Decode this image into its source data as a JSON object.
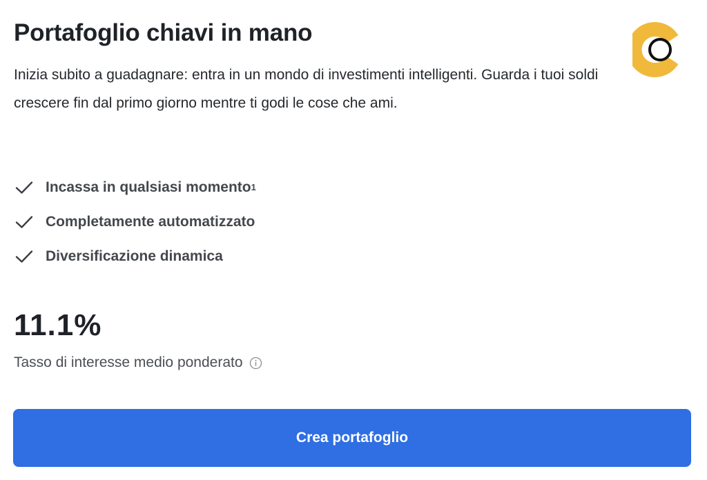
{
  "card": {
    "title": "Portafoglio chiavi in mano",
    "description": "Inizia subito a guadagnare: entra in un mondo di investimenti intelligenti. Guarda i tuoi soldi crescere fin dal primo giorno mentre ti godi le cose che ami.",
    "logo_icon": "brand-logo-icon",
    "features": [
      {
        "label": "Incassa in qualsiasi momento",
        "superscript": "1",
        "icon": "checkmark-icon"
      },
      {
        "label": "Completamente automatizzato",
        "icon": "checkmark-icon"
      },
      {
        "label": "Diversificazione dinamica",
        "icon": "checkmark-icon"
      }
    ],
    "rate": {
      "value": "11.1%",
      "label": "Tasso di interesse medio ponderato",
      "info_icon": "info-icon"
    },
    "cta_label": "Crea portafoglio"
  },
  "colors": {
    "accent": "#2f6ee3",
    "logo_yellow": "#f1b93b",
    "text_primary": "#1f2227",
    "text_secondary": "#44474c"
  }
}
